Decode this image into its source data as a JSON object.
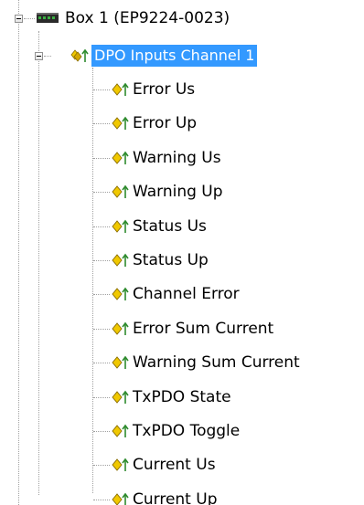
{
  "tree": {
    "root": {
      "label": "Box 1 (EP9224-0023)",
      "icon": "ethercat-box-icon",
      "expanded": true
    },
    "channel": {
      "label": "DPO Inputs Channel 1",
      "icon": "input-variables-icon",
      "expanded": true,
      "selected": true
    },
    "items": [
      {
        "label": "Error Us",
        "icon": "input-variable-icon"
      },
      {
        "label": "Error Up",
        "icon": "input-variable-icon"
      },
      {
        "label": "Warning Us",
        "icon": "input-variable-icon"
      },
      {
        "label": "Warning Up",
        "icon": "input-variable-icon"
      },
      {
        "label": "Status Us",
        "icon": "input-variable-icon"
      },
      {
        "label": "Status Up",
        "icon": "input-variable-icon"
      },
      {
        "label": "Channel Error",
        "icon": "input-variable-icon"
      },
      {
        "label": "Error Sum Current",
        "icon": "input-variable-icon"
      },
      {
        "label": "Warning Sum Current",
        "icon": "input-variable-icon"
      },
      {
        "label": "TxPDO State",
        "icon": "input-variable-icon"
      },
      {
        "label": "TxPDO Toggle",
        "icon": "input-variable-icon"
      },
      {
        "label": "Current Us",
        "icon": "input-variable-icon"
      },
      {
        "label": "Current Up",
        "icon": "input-variable-icon"
      }
    ]
  },
  "colors": {
    "selection": "#3399ff",
    "icon_yellow": "#f0c800",
    "icon_green": "#2e8b2e"
  }
}
